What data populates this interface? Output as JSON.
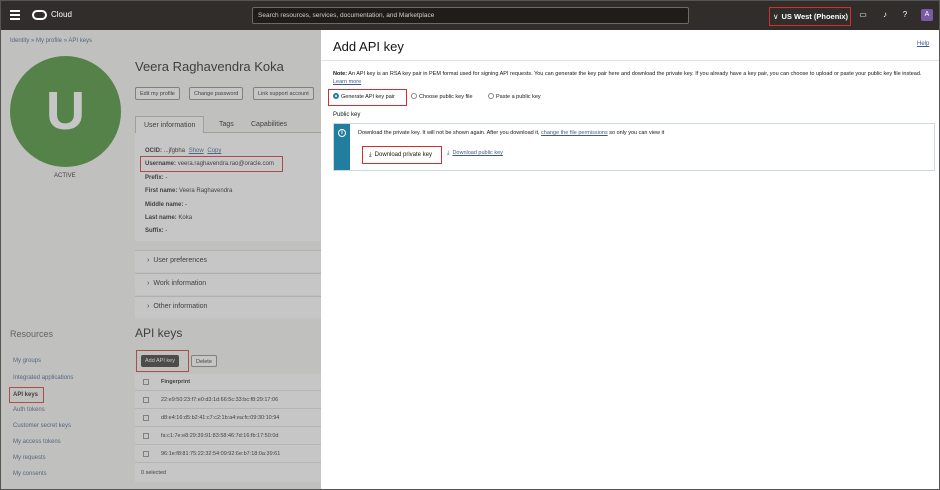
{
  "topbar": {
    "logo_text": "Cloud",
    "search_placeholder": "Search resources, services, documentation, and Marketplace",
    "region_label": "US West (Phoenix)",
    "user_initial": "A"
  },
  "breadcrumb": "Identity » My profile » API keys",
  "profile": {
    "avatar_letter": "U",
    "status": "ACTIVE",
    "name": "Veera Raghavendra Koka",
    "buttons": [
      "Edit my profile",
      "Change password",
      "Link support account"
    ],
    "tabs": [
      "User information",
      "Tags",
      "Capabilities"
    ],
    "info": {
      "ocid_label": "OCID:",
      "ocid_value": "...jfgbha",
      "ocid_show": "Show",
      "ocid_copy": "Copy",
      "username_label": "Username:",
      "username_value": "veera.raghavendra.rao@oracle.com",
      "prefix_label": "Prefix:",
      "prefix_value": "-",
      "first_label": "First name:",
      "first_value": "Veera Raghavendra",
      "middle_label": "Middle name:",
      "middle_value": "-",
      "last_label": "Last name:",
      "last_value": "Koka",
      "suffix_label": "Suffix:",
      "suffix_value": "-"
    },
    "accordions": [
      "User preferences",
      "Work information",
      "Other information"
    ]
  },
  "resources": {
    "title": "Resources",
    "items": [
      "My groups",
      "Integrated applications",
      "API keys",
      "Auth tokens",
      "Customer secret keys",
      "My access tokens",
      "My requests",
      "My consents"
    ]
  },
  "api_keys": {
    "title": "API keys",
    "add_button": "Add API key",
    "delete_button": "Delete",
    "column": "Fingerprint",
    "rows": [
      "22:e9:50:23:f7:e0:d3:1d:66:5c:33:bc:f8:29:17:06",
      "d8:e4:16:d5:b2:41:c7:c2:1b:a4:ea:fc:09:30:10:94",
      "fa:c1:7e:e8:29:39:91:83:58:46:7d:16:fb:17:50:0d",
      "96:1e:f8:81:75:22:32:54:09:92:6e:b7:18:0a:39:61"
    ],
    "selected": "0 selected"
  },
  "panel": {
    "title": "Add API key",
    "help": "Help",
    "note_label": "Note:",
    "note_text": "An API key is an RSA key pair in PEM format used for signing API requests. You can generate the key pair here and download the private key. If you already have a key pair, you can choose to upload or paste your public key file instead.",
    "learn_more": "Learn more",
    "options": [
      "Generate API key pair",
      "Choose public key file",
      "Paste a public key"
    ],
    "public_key_label": "Public key",
    "info_text_1": "Download the private key. It will not be shown again. After you download it,",
    "info_link": "change the file permissions",
    "info_text_2": "so only you can view it",
    "download_private": "Download private key",
    "download_public": "Download public key"
  }
}
